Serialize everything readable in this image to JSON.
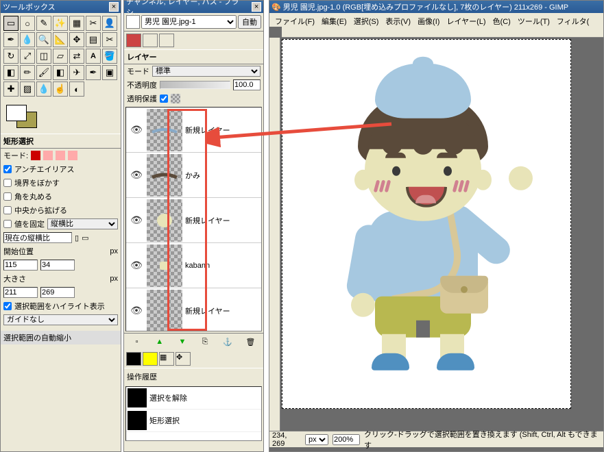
{
  "toolbox": {
    "title": "ツールボックス",
    "section_rect": "矩形選択",
    "mode_label": "モード:",
    "antialias": "アンチエイリアス",
    "blur_edge": "境界をぼかす",
    "round_corner": "角を丸める",
    "expand_center": "中央から拡げる",
    "fix_value": "値を固定",
    "aspect_ratio_type": "縦横比",
    "current_ratio": "現在の縦横比",
    "start_pos": "開始位置",
    "start_x": "115",
    "start_y": "34",
    "size_label": "大きさ",
    "size_w": "211",
    "size_h": "269",
    "highlight_sel": "選択範囲をハイライト表示",
    "guide": "ガイドなし",
    "autoshrink": "選択範囲の自動縮小",
    "px": "px"
  },
  "layers": {
    "title": "チャンネル, レイヤー, パス - ブラシ...",
    "image_name": "男児 園児.jpg-1",
    "auto_btn": "自動",
    "layers_label": "レイヤー",
    "mode_label": "モード",
    "mode_value": "標準",
    "opacity_label": "不透明度",
    "opacity_value": "100.0",
    "protect_trans": "透明保護",
    "items": [
      {
        "name": "新規レイヤー"
      },
      {
        "name": "かみ"
      },
      {
        "name": "新規レイヤー"
      },
      {
        "name": "kabann"
      },
      {
        "name": "新規レイヤー"
      }
    ],
    "history_label": "操作履歴",
    "history": [
      {
        "label": "選択を解除"
      },
      {
        "label": "矩形選択"
      }
    ]
  },
  "imgwin": {
    "title": "男児 園児.jpg-1.0 (RGB[埋め込みプロファイルなし], 7枚のレイヤー) 211x269 - GIMP",
    "menu": {
      "file": "ファイル(F)",
      "edit": "編集(E)",
      "select": "選択(S)",
      "view": "表示(V)",
      "image": "画像(I)",
      "layer": "レイヤー(L)",
      "color": "色(C)",
      "tool": "ツール(T)",
      "filter": "フィルタ("
    },
    "status": {
      "coords": "234, 269",
      "unit": "px",
      "zoom": "200%",
      "hint": "クリック-ドラッグで選択範囲を置き換えます (Shift, Ctrl, Alt もできます"
    }
  }
}
